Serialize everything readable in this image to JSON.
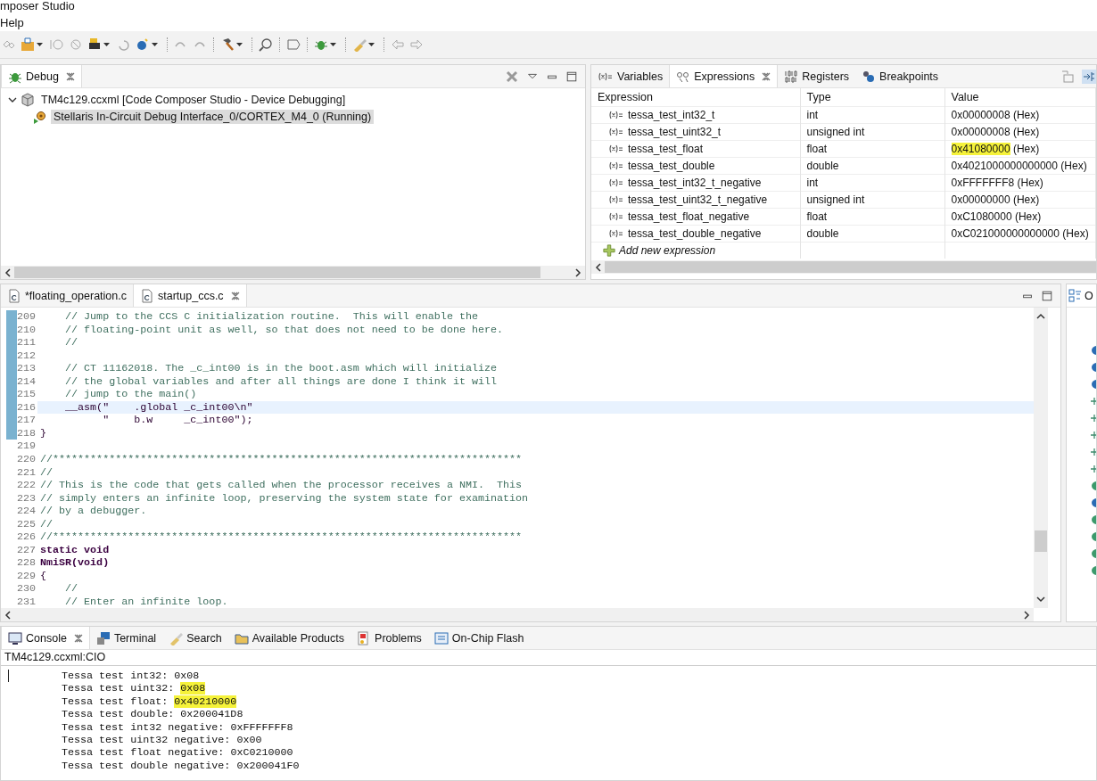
{
  "window": {
    "title": "mposer Studio"
  },
  "menu": [
    "Help"
  ],
  "debug_view": {
    "tabs": [
      {
        "label": "Debug",
        "selected": true
      }
    ],
    "tree": [
      {
        "label": "TM4c129.ccxml [Code Composer Studio - Device Debugging]",
        "expanded": true,
        "selected": false,
        "children": [
          {
            "label": "Stellaris In-Circuit Debug Interface_0/CORTEX_M4_0 (Running)",
            "selected": true
          }
        ]
      }
    ]
  },
  "expressions_view": {
    "tabs": [
      {
        "label": "Variables",
        "selected": false
      },
      {
        "label": "Expressions",
        "selected": true
      },
      {
        "label": "Registers",
        "selected": false
      },
      {
        "label": "Breakpoints",
        "selected": false
      }
    ],
    "columns": [
      "Expression",
      "Type",
      "Value"
    ],
    "rows": [
      {
        "expression": "tessa_test_int32_t",
        "type": "int",
        "value": "0x00000008",
        "format": "(Hex)",
        "highlighted": false
      },
      {
        "expression": "tessa_test_uint32_t",
        "type": "unsigned int",
        "value": "0x00000008",
        "format": "(Hex)",
        "highlighted": false
      },
      {
        "expression": "tessa_test_float",
        "type": "float",
        "value": "0x41080000",
        "format": "(Hex)",
        "highlighted": true
      },
      {
        "expression": "tessa_test_double",
        "type": "double",
        "value": "0x4021000000000000",
        "format": "(Hex)",
        "highlighted": false
      },
      {
        "expression": "tessa_test_int32_t_negative",
        "type": "int",
        "value": "0xFFFFFFF8",
        "format": "(Hex)",
        "highlighted": false
      },
      {
        "expression": "tessa_test_uint32_t_negative",
        "type": "unsigned int",
        "value": "0x00000000",
        "format": "(Hex)",
        "highlighted": false
      },
      {
        "expression": "tessa_test_float_negative",
        "type": "float",
        "value": "0xC1080000",
        "format": "(Hex)",
        "highlighted": false
      },
      {
        "expression": "tessa_test_double_negative",
        "type": "double",
        "value": "0xC021000000000000",
        "format": "(Hex)",
        "highlighted": false
      }
    ],
    "add_row": "Add new expression"
  },
  "editor": {
    "tabs": [
      {
        "label": "*floating_operation.c",
        "selected": false
      },
      {
        "label": "startup_ccs.c",
        "selected": true
      }
    ],
    "lines": [
      {
        "number": "209",
        "kind": "comment",
        "text": "    // Jump to the CCS C initialization routine.  This will enable the",
        "changed": true,
        "current": false
      },
      {
        "number": "210",
        "kind": "comment",
        "text": "    // floating-point unit as well, so that does not need to be done here.",
        "changed": true,
        "current": false
      },
      {
        "number": "211",
        "kind": "comment",
        "text": "    //",
        "changed": true,
        "current": false
      },
      {
        "number": "212",
        "changed": true,
        "current": false
      },
      {
        "number": "213",
        "kind": "comment",
        "text": "    // CT 11162018. The _c_int00 is in the boot.asm which will initialize",
        "changed": true,
        "current": false
      },
      {
        "number": "214",
        "kind": "comment",
        "text": "    // the global variables and after all things are done I think it will",
        "changed": true,
        "current": false
      },
      {
        "number": "215",
        "kind": "comment",
        "text": "    // jump to the main()",
        "changed": true,
        "current": false
      },
      {
        "number": "216",
        "kind": "code",
        "text": "    __asm(\"    .global _c_int00\\n\"",
        "changed": true,
        "current": true
      },
      {
        "number": "217",
        "kind": "code",
        "text": "          \"    b.w     _c_int00\");",
        "changed": true,
        "current": false
      },
      {
        "number": "218",
        "kind": "code",
        "text": "}",
        "changed": true,
        "current": false
      },
      {
        "number": "219",
        "changed": false,
        "current": false
      },
      {
        "number": "220",
        "kind": "comment",
        "text": "//***************************************************************************",
        "changed": false,
        "current": false
      },
      {
        "number": "221",
        "kind": "comment",
        "text": "//",
        "changed": false,
        "current": false
      },
      {
        "number": "222",
        "kind": "comment",
        "text": "// This is the code that gets called when the processor receives a NMI.  This",
        "changed": false,
        "current": false
      },
      {
        "number": "223",
        "kind": "comment",
        "text": "// simply enters an infinite loop, preserving the system state for examination",
        "changed": false,
        "current": false
      },
      {
        "number": "224",
        "kind": "comment",
        "text": "// by a debugger.",
        "changed": false,
        "current": false
      },
      {
        "number": "225",
        "kind": "comment",
        "text": "//",
        "changed": false,
        "current": false
      },
      {
        "number": "226",
        "kind": "comment",
        "text": "//***************************************************************************",
        "changed": false,
        "current": false
      },
      {
        "number": "227",
        "kind": "keyword",
        "text": "static void",
        "changed": false,
        "current": false
      },
      {
        "number": "228",
        "kind": "keyword",
        "text": "NmiSR(void)",
        "changed": false,
        "current": false
      },
      {
        "number": "229",
        "kind": "code",
        "text": "{",
        "changed": false,
        "current": false
      },
      {
        "number": "230",
        "kind": "comment",
        "text": "    //",
        "changed": false,
        "current": false
      },
      {
        "number": "231",
        "kind": "comment",
        "text": "    // Enter an infinite loop.",
        "changed": false,
        "current": false
      }
    ]
  },
  "outline": {
    "tabs": [
      {
        "label": "O",
        "selected": false
      }
    ]
  },
  "console": {
    "tabs": [
      {
        "label": "Console",
        "selected": true
      },
      {
        "label": "Terminal",
        "selected": false
      },
      {
        "label": "Search",
        "selected": false
      },
      {
        "label": "Available Products",
        "selected": false
      },
      {
        "label": "Problems",
        "selected": false
      },
      {
        "label": "On-Chip Flash",
        "selected": false
      }
    ],
    "source": "TM4c129.ccxml:CIO",
    "lines": [
      {
        "label": "Tessa test int32:",
        "value": "0x08",
        "highlighted": false
      },
      {
        "label": "Tessa test uint32:",
        "value": "0x08",
        "highlighted": true
      },
      {
        "label": "Tessa test float:",
        "value": "0x40210000",
        "highlighted": true
      },
      {
        "label": "Tessa test double:",
        "value": "0x200041D8",
        "highlighted": false
      },
      {
        "label": "Tessa test int32 negative:",
        "value": "0xFFFFFFF8",
        "highlighted": false
      },
      {
        "label": "Tessa test uint32 negative:",
        "value": "0x00",
        "highlighted": false
      },
      {
        "label": "Tessa test float negative:",
        "value": "0xC0210000",
        "highlighted": false
      },
      {
        "label": "Tessa test double negative:",
        "value": "0x200041F0",
        "highlighted": false
      }
    ]
  }
}
